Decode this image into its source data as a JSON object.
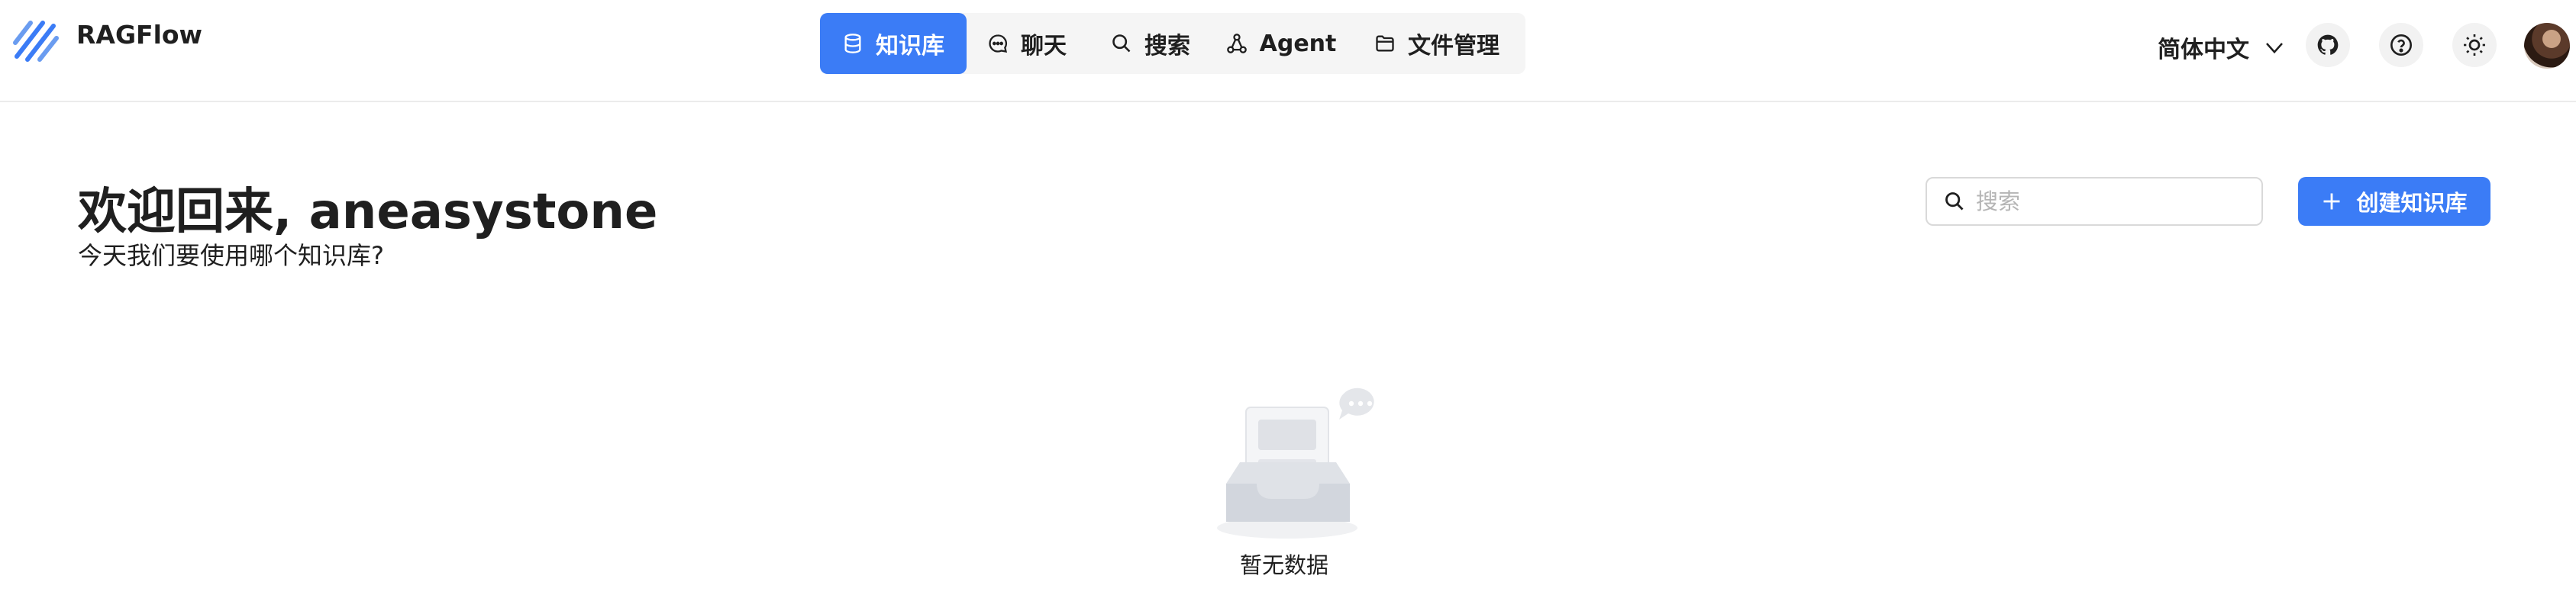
{
  "app": {
    "name": "RAGFlow"
  },
  "nav": {
    "items": [
      {
        "label": "知识库",
        "icon": "database-icon",
        "active": true
      },
      {
        "label": "聊天",
        "icon": "chat-icon",
        "active": false
      },
      {
        "label": "搜索",
        "icon": "search-icon",
        "active": false
      },
      {
        "label": "Agent",
        "icon": "agent-icon",
        "active": false
      },
      {
        "label": "文件管理",
        "icon": "folder-icon",
        "active": false
      }
    ]
  },
  "header": {
    "language": "简体中文",
    "icons": [
      "github-icon",
      "help-icon",
      "sun-icon"
    ]
  },
  "main": {
    "title": "欢迎回来, aneasystone",
    "subtitle": "今天我们要使用哪个知识库?",
    "search": {
      "placeholder": "搜索",
      "value": ""
    },
    "create_button": "创建知识库",
    "empty_text": "暂无数据"
  },
  "colors": {
    "accent": "#3b7cf6",
    "nav_bg": "#f5f5f5"
  }
}
